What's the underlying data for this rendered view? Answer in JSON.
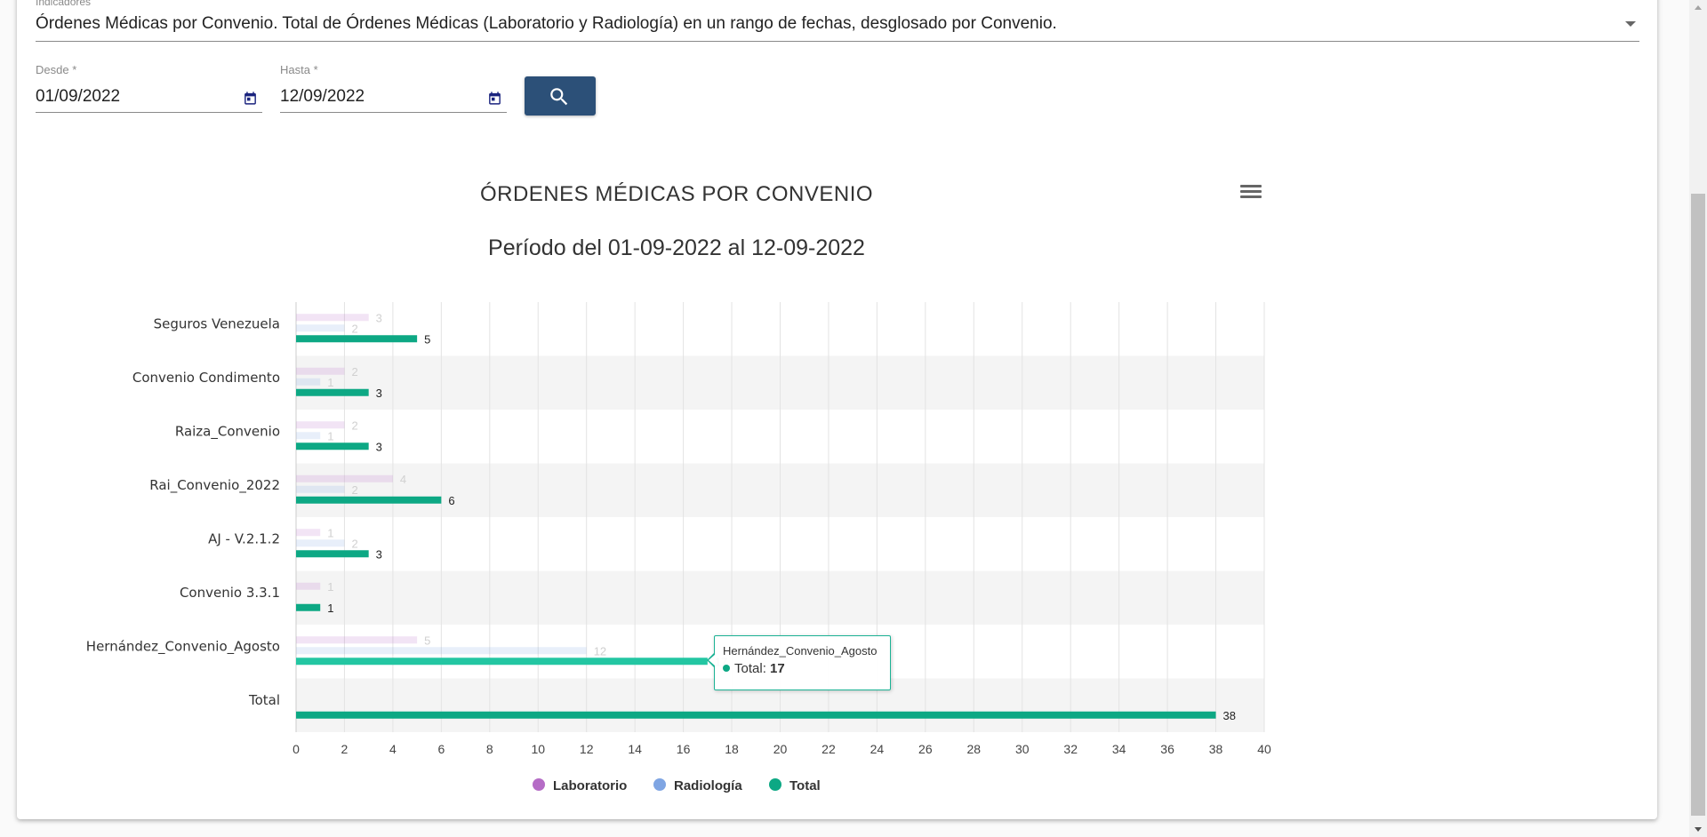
{
  "indicator": {
    "label": "Indicadores",
    "value": "Órdenes Médicas por Convenio. Total de Órdenes Médicas (Laboratorio y Radiología) en un rango de fechas, desglosado por Convenio."
  },
  "desde": {
    "label": "Desde *",
    "value": "01/09/2022"
  },
  "hasta": {
    "label": "Hasta *",
    "value": "12/09/2022"
  },
  "icons": {
    "calendar": "calendar-icon",
    "search": "search-icon",
    "menu": "hamburger-menu-icon"
  },
  "colors": {
    "laboratorio": "#b56cc6",
    "radiologia": "#7fa5e3",
    "total": "#0da884",
    "button": "#2c5078"
  },
  "tooltip": {
    "title": "Hernández_Convenio_Agosto",
    "series": "Total",
    "value": "17"
  },
  "chart_data": {
    "type": "bar",
    "orientation": "horizontal",
    "title": "ÓRDENES MÉDICAS POR CONVENIO",
    "subtitle": "Período del 01-09-2022 al 12-09-2022",
    "categories": [
      "Seguros Venezuela",
      "Convenio Condimento",
      "Raiza_Convenio",
      "Rai_Convenio_2022",
      "AJ - V.2.1.2",
      "Convenio 3.3.1",
      "Hernández_Convenio_Agosto",
      "Total"
    ],
    "series": [
      {
        "name": "Laboratorio",
        "values": [
          3,
          2,
          2,
          4,
          1,
          1,
          5,
          null
        ]
      },
      {
        "name": "Radiología",
        "values": [
          2,
          1,
          1,
          2,
          2,
          null,
          12,
          null
        ]
      },
      {
        "name": "Total",
        "values": [
          5,
          3,
          3,
          6,
          3,
          1,
          17,
          38
        ]
      }
    ],
    "xlim": [
      0,
      40
    ],
    "xticks": [
      0,
      2,
      4,
      6,
      8,
      10,
      12,
      14,
      16,
      18,
      20,
      22,
      24,
      26,
      28,
      30,
      32,
      34,
      36,
      38,
      40
    ],
    "grid": true,
    "legend": "bottom-center",
    "hovered_category": "Hernández_Convenio_Agosto"
  }
}
